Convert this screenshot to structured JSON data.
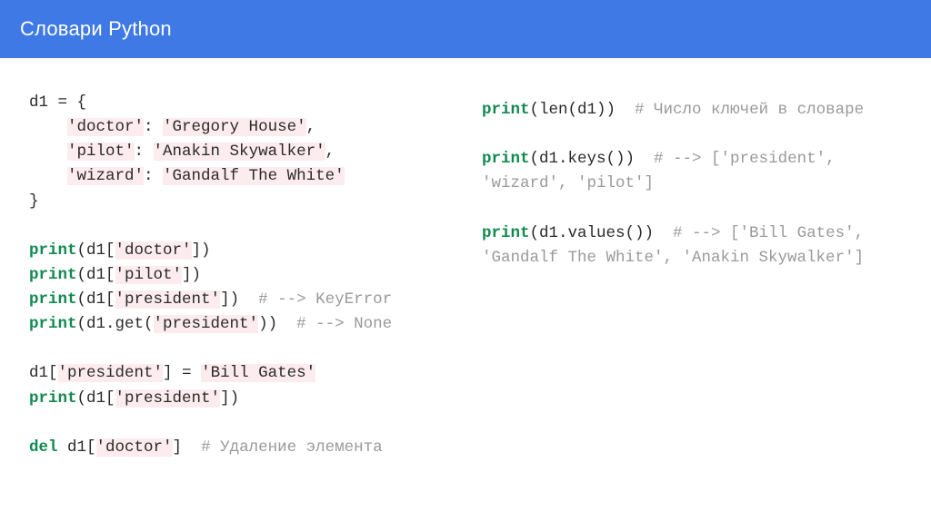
{
  "header": {
    "title": "Словари Python"
  },
  "code": {
    "d1_assign": "d1 = {",
    "d1_kv1_k": "'doctor'",
    "d1_kv1_sep": ": ",
    "d1_kv1_v": "'Gregory House'",
    "d1_kv1_tail": ",",
    "d1_kv2_k": "'pilot'",
    "d1_kv2_sep": ": ",
    "d1_kv2_v": "'Anakin Skywalker'",
    "d1_kv2_tail": ",",
    "d1_kv3_k": "'wizard'",
    "d1_kv3_sep": ": ",
    "d1_kv3_v": "'Gandalf The White'",
    "d1_close": "}",
    "print_kw": "print",
    "p1_open": "(d1[",
    "p1_arg": "'doctor'",
    "p1_close": "])",
    "p2_open": "(d1[",
    "p2_arg": "'pilot'",
    "p2_close": "])",
    "p3_open": "(d1[",
    "p3_arg": "'president'",
    "p3_close": "])  ",
    "p3_cmt": "# --> KeyError",
    "p4_open": "(d1.get(",
    "p4_arg": "'president'",
    "p4_close": "))  ",
    "p4_cmt": "# --> None",
    "assign2_pre": "d1[",
    "assign2_key": "'president'",
    "assign2_mid": "] = ",
    "assign2_val": "'Bill Gates'",
    "p5_open": "(d1[",
    "p5_arg": "'president'",
    "p5_close": "])",
    "del_kw": "del",
    "del_pre": " d1[",
    "del_arg": "'doctor'",
    "del_close": "]  ",
    "del_cmt": "# Удаление элемента",
    "r1_open": "(len(d1))  ",
    "r1_cmt": "# Число ключей в словаре",
    "r2_open": "(d1.keys())  ",
    "r2_cmt": "# --> ['president', 'wizard', 'pilot']",
    "r3_open": "(d1.values())  ",
    "r3_cmt": "# --> ['Bill Gates', 'Gandalf The White', 'Anakin Skywalker']"
  }
}
